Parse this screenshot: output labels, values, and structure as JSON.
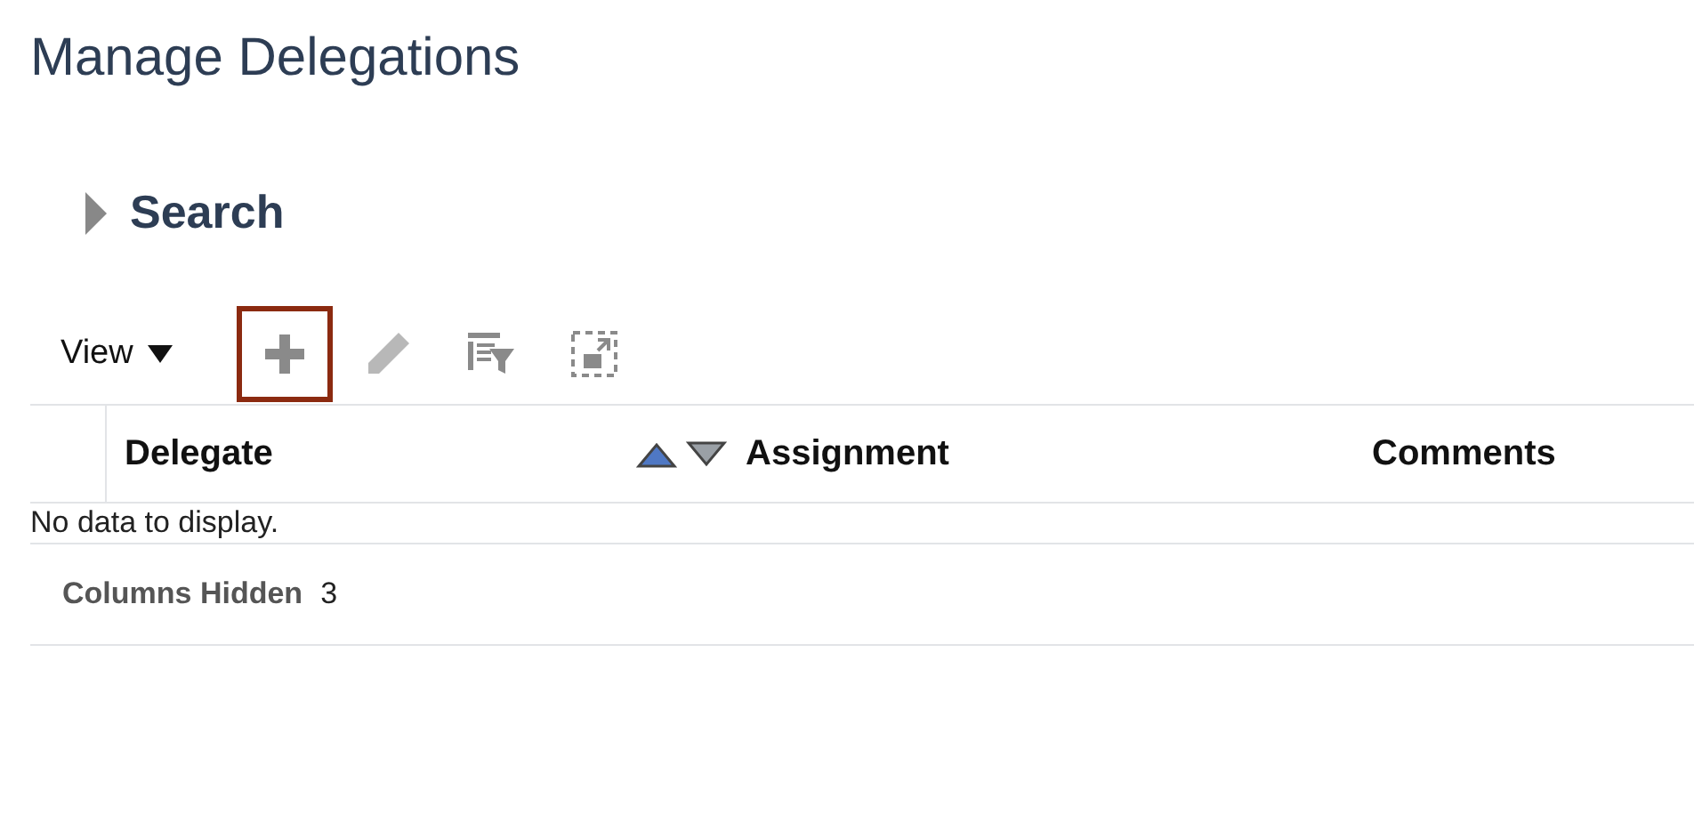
{
  "page_title": "Manage Delegations",
  "search": {
    "label": "Search",
    "expanded": false
  },
  "toolbar": {
    "view_label": "View",
    "buttons": [
      {
        "kind": "add",
        "highlighted": true,
        "disabled": false
      },
      {
        "kind": "edit",
        "highlighted": false,
        "disabled": true
      },
      {
        "kind": "filter",
        "highlighted": false,
        "disabled": false
      },
      {
        "kind": "detach",
        "highlighted": false,
        "disabled": false
      }
    ]
  },
  "table": {
    "columns": [
      {
        "label": "Delegate",
        "sorted": true,
        "ascending": true
      },
      {
        "label": "Assignment",
        "sorted": false
      },
      {
        "label": "Comments",
        "sorted": false
      }
    ],
    "empty_message": "No data to display."
  },
  "status_bar": {
    "label": "Columns Hidden",
    "count": "3"
  }
}
